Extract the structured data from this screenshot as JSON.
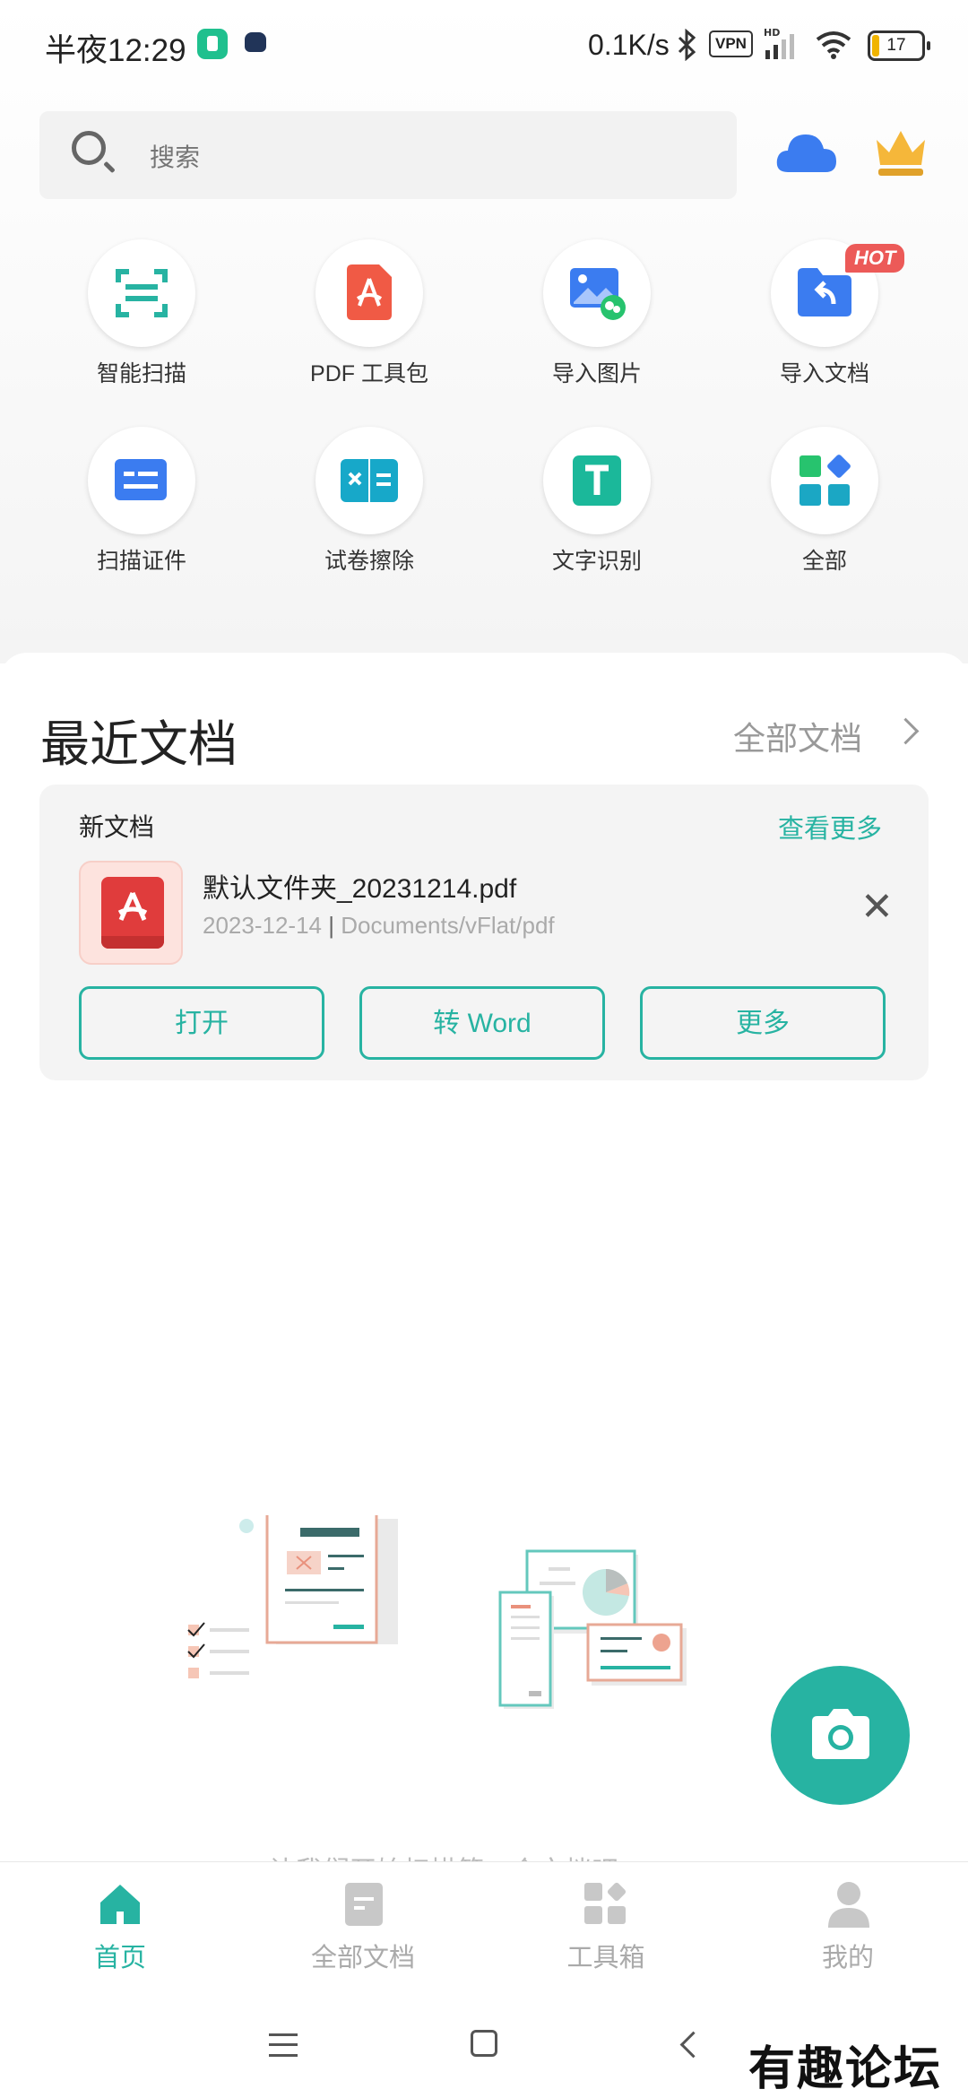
{
  "status_bar": {
    "time": "半夜12:29",
    "net_speed": "0.1K/s",
    "vpn": "VPN",
    "battery": "17"
  },
  "search": {
    "placeholder": "搜索"
  },
  "tools": [
    {
      "label": "智能扫描",
      "icon": "scan-icon"
    },
    {
      "label": "PDF 工具包",
      "icon": "pdf-toolkit-icon"
    },
    {
      "label": "导入图片",
      "icon": "import-image-icon"
    },
    {
      "label": "导入文档",
      "icon": "import-document-icon",
      "badge": "HOT"
    },
    {
      "label": "扫描证件",
      "icon": "id-card-icon"
    },
    {
      "label": "试卷擦除",
      "icon": "exam-erase-icon"
    },
    {
      "label": "文字识别",
      "icon": "text-recognition-icon"
    },
    {
      "label": "全部",
      "icon": "all-tools-icon"
    }
  ],
  "recent": {
    "title": "最近文档",
    "all_docs": "全部文档",
    "card": {
      "heading": "新文档",
      "view_more": "查看更多",
      "file_name": "默认文件夹_20231214.pdf",
      "date": "2023-12-14",
      "path": "Documents/vFlat/pdf",
      "buttons": {
        "open": "打开",
        "to_word": "转 Word",
        "more": "更多"
      }
    }
  },
  "hint": "让我们开始扫描第一个文档吧",
  "nav": [
    {
      "label": "首页",
      "active": true
    },
    {
      "label": "全部文档",
      "active": false
    },
    {
      "label": "工具箱",
      "active": false
    },
    {
      "label": "我的",
      "active": false
    }
  ],
  "watermark": "有趣论坛",
  "colors": {
    "accent": "#27b3a2",
    "hot": "#ec5a58",
    "pdf_red": "#e03c3c"
  }
}
